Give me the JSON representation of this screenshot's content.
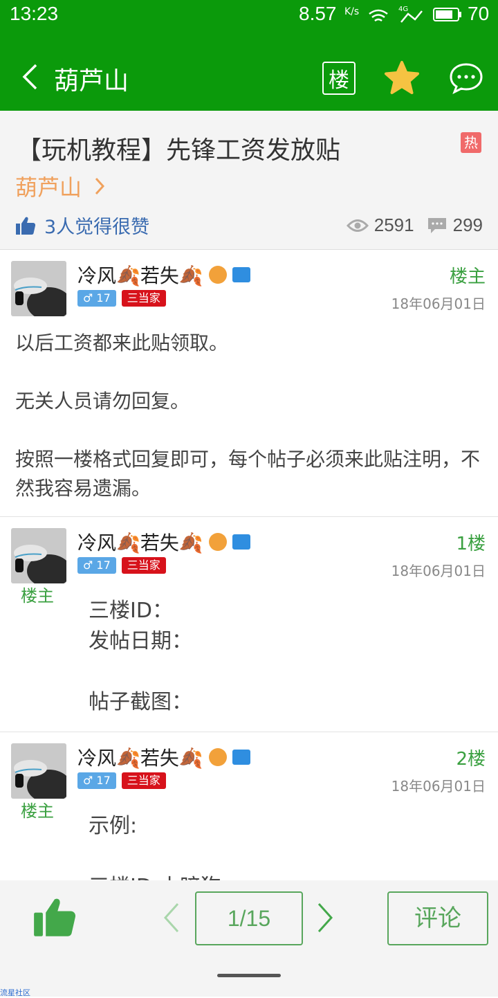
{
  "status_bar": {
    "time": "13:23",
    "net_speed": "8.57",
    "net_speed_unit": "K/s",
    "network": "4G",
    "battery": "70"
  },
  "header": {
    "title": "葫芦山",
    "floor_btn": "楼",
    "icons": [
      "back-icon",
      "floor-icon",
      "star-icon",
      "chat-bubble-icon"
    ]
  },
  "thread": {
    "title": "【玩机教程】先锋工资发放贴",
    "hot_badge": "热",
    "forum": "葫芦山",
    "likes_text": "3人觉得很赞",
    "views": "2591",
    "comments": "299"
  },
  "posts": [
    {
      "username": "冷风🍂若失🍂",
      "gender_level": "♂ 17",
      "rank": "三当家",
      "floor": "楼主",
      "date": "18年06月01日",
      "owner_tag": "",
      "content": "以后工资都来此贴领取。\n\n无关人员请勿回复。\n\n按照一楼格式回复即可，每个帖子必须来此贴注明，不然我容易遗漏。"
    },
    {
      "username": "冷风🍂若失🍂",
      "gender_level": "♂ 17",
      "rank": "三当家",
      "floor": "1楼",
      "date": "18年06月01日",
      "owner_tag": "楼主",
      "content": "三楼ID：\n发帖日期：\n\n帖子截图："
    },
    {
      "username": "冷风🍂若失🍂",
      "gender_level": "♂ 17",
      "rank": "三当家",
      "floor": "2楼",
      "date": "18年06月01日",
      "owner_tag": "楼主",
      "content": "示例:\n\n三楼ID:小暗狗"
    }
  ],
  "bottom": {
    "page": "1/15",
    "comment_btn": "评论"
  },
  "watermark": "流星社区",
  "colors": {
    "header_green": "#0b9a0b",
    "accent_green": "#58a65c",
    "forum_orange": "#f0a15d",
    "rank_red": "#d7121b"
  }
}
